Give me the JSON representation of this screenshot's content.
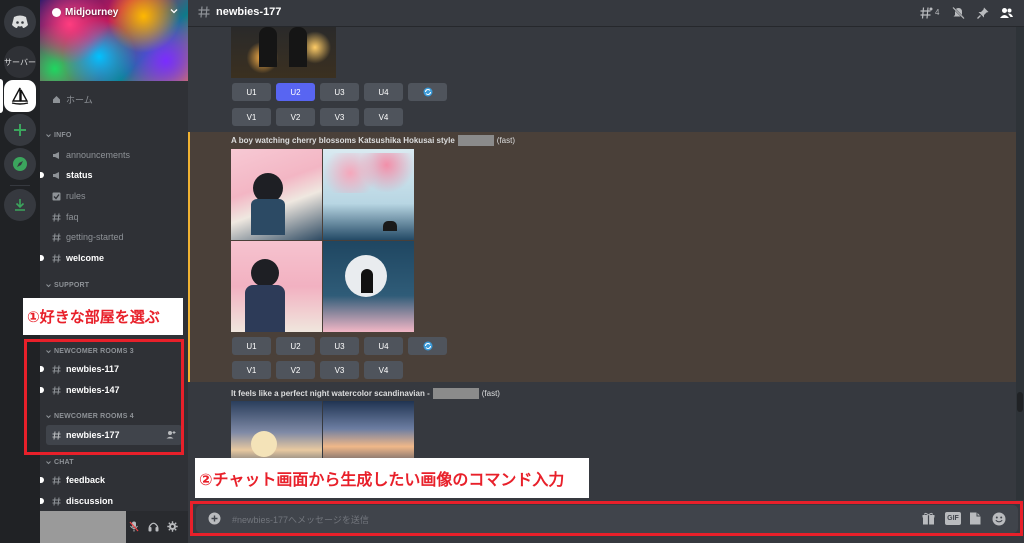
{
  "server": {
    "name": "Midjourney"
  },
  "rail": {
    "server_label": "サーバー"
  },
  "sidebar": {
    "home": "ホーム",
    "categories": {
      "info": "INFO",
      "support": "SUPPORT",
      "newcomer3": "NEWCOMER ROOMS 3",
      "newcomer4": "NEWCOMER ROOMS 4",
      "chat": "CHAT"
    },
    "channels": {
      "announcements": "announcements",
      "status": "status",
      "rules": "rules",
      "faq": "faq",
      "getting_started": "getting-started",
      "welcome": "welcome",
      "newbies117": "newbies-117",
      "newbies147": "newbies-147",
      "newbies177": "newbies-177",
      "feedback": "feedback",
      "discussion": "discussion"
    }
  },
  "header": {
    "channel": "newbies-177",
    "thread_count": "4"
  },
  "messages": {
    "buttons_u": [
      "U1",
      "U2",
      "U3",
      "U4"
    ],
    "buttons_v": [
      "V1",
      "V2",
      "V3",
      "V4"
    ],
    "prompt1": "A boy watching cherry blossoms Katsushika Hokusai style",
    "prompt1_suffix": "(fast)",
    "prompt2": "It feels like a perfect night watercolor scandinavian -",
    "prompt2_suffix": "(fast)"
  },
  "input": {
    "placeholder": "#newbies-177へメッセージを送信",
    "gif_label": "GIF"
  },
  "annotations": {
    "room": "①好きな部屋を選ぶ",
    "command": "②チャット画面から生成したい画像のコマンド入力"
  },
  "colors": {
    "accent": "#5865f2",
    "annotation_red": "#e8202a",
    "highlight_bg": "#4a4039",
    "highlight_border": "#f0b232",
    "rail_green": "#3ba55d"
  }
}
